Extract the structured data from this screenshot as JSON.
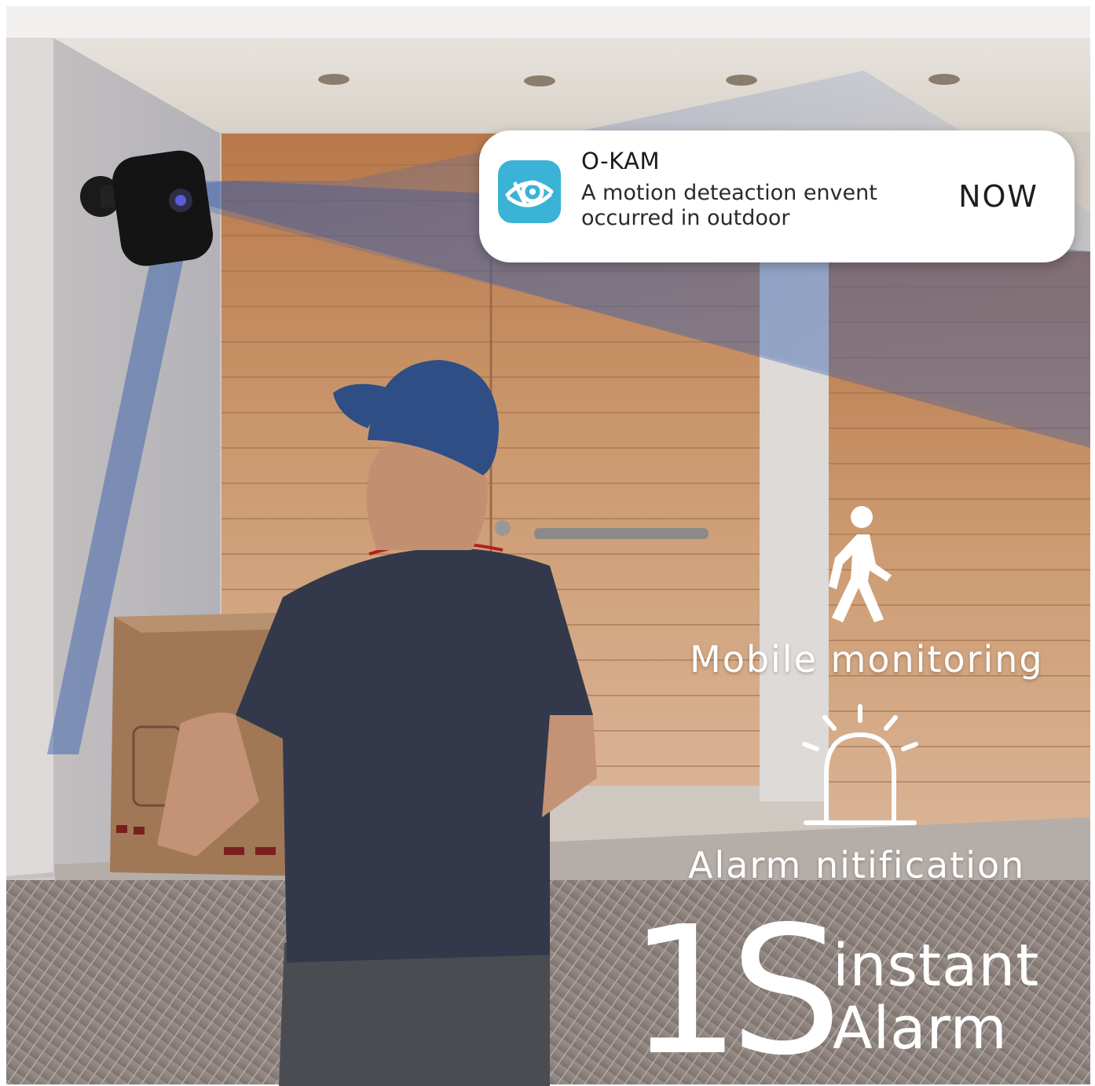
{
  "notification": {
    "app_name": "O-KAM",
    "message_line1": "A motion deteaction envent",
    "message_line2": "occurred in outdoor",
    "time": "NOW",
    "app_icon": "eye-camera-icon"
  },
  "features": [
    {
      "icon": "walking-person-icon",
      "label": "Mobile monitoring"
    },
    {
      "icon": "alarm-siren-icon",
      "label": "Alarm nitification"
    }
  ],
  "headline": {
    "big": "1S",
    "line1": "instant",
    "line2": "Alarm"
  },
  "colors": {
    "camera_beam": "#3a5fa0",
    "app_icon_bg": "#3bb3d6",
    "door_wood": "#c9956a"
  }
}
